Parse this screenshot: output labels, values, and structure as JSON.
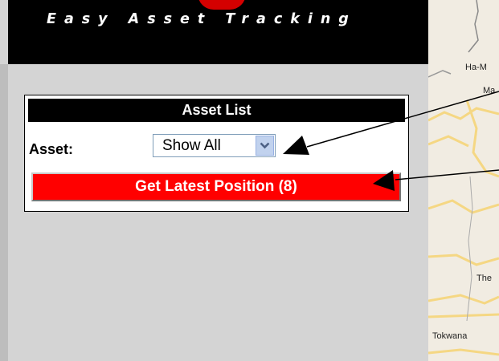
{
  "header": {
    "tagline": "Easy Asset Tracking"
  },
  "asset_list": {
    "title": "Asset List",
    "asset_label": "Asset:",
    "asset_select_value": "Show All",
    "get_position_button": "Get Latest Position (8)"
  },
  "map": {
    "places": [
      "Ha-M",
      "Ma",
      "The",
      "Tokwana"
    ]
  },
  "colors": {
    "header_bg": "#000000",
    "button_bg": "#ff0000",
    "sidebar_bg": "#d4d4d4",
    "map_bg": "#f1ece2"
  }
}
